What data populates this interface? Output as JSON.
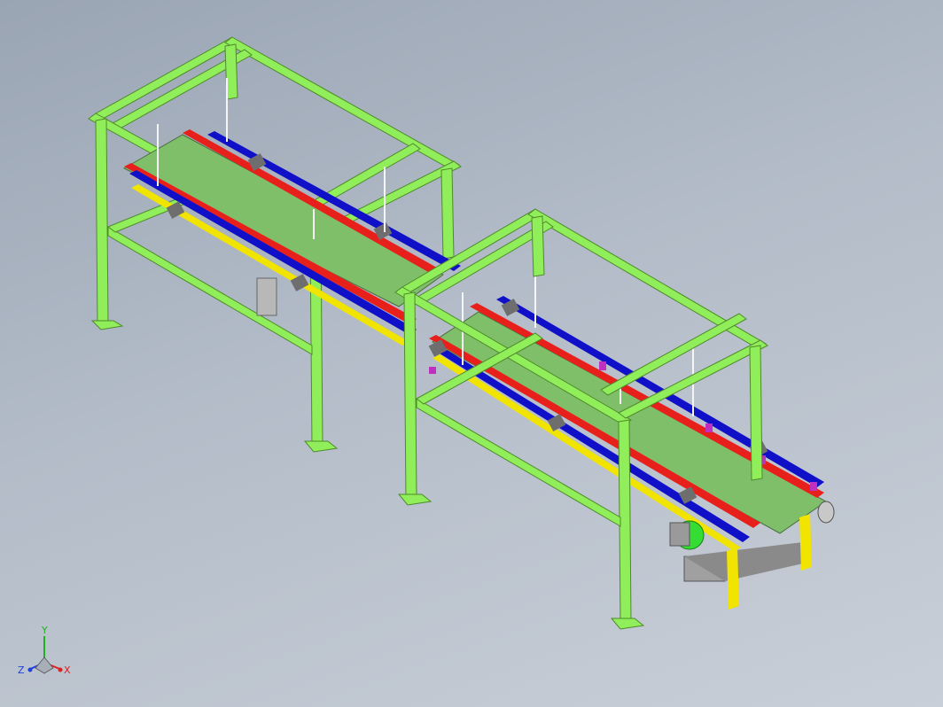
{
  "viewport": {
    "background_top": "#9aa5b4",
    "background_bottom": "#c9cfd8"
  },
  "model": {
    "frame_color": "#90ee5a",
    "belt_color": "#7fbf6a",
    "guard_rail_red": "#e8201c",
    "guard_rail_blue": "#1010c8",
    "base_rail_yellow": "#f0e400",
    "bracket_color": "#6e6e6e",
    "motor_color": "#33dd33",
    "end_cap_magenta": "#c030c0"
  },
  "triad": {
    "x_label": "X",
    "y_label": "Y",
    "z_label": "Z",
    "x_color": "#e02020",
    "y_color": "#20b020",
    "z_color": "#2040e0"
  }
}
